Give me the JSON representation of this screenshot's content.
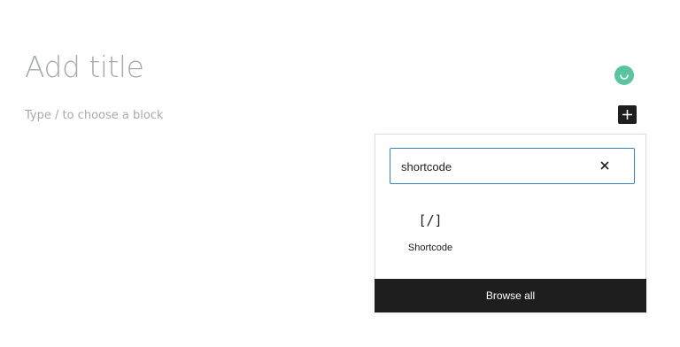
{
  "editor": {
    "title_placeholder": "Add title",
    "block_placeholder": "Type / to choose a block"
  },
  "toolbar": {
    "add_block_icon": "plus-icon",
    "status_icon": "loading-circle-icon",
    "status_color": "#5bc3a0"
  },
  "inserter": {
    "search": {
      "value": "shortcode",
      "clear_icon": "close-icon"
    },
    "results": [
      {
        "icon_text": "[/]",
        "label": "Shortcode"
      }
    ],
    "browse_all_label": "Browse all"
  }
}
